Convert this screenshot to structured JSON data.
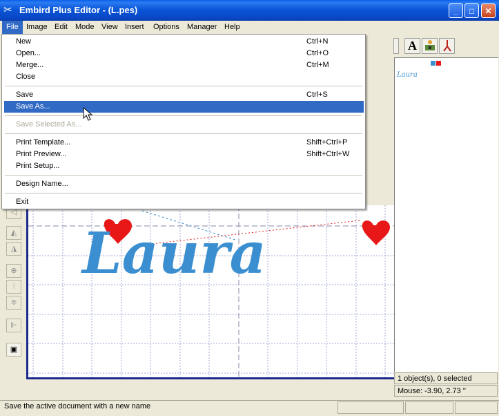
{
  "window": {
    "title": "Embird Plus Editor - (L.pes)"
  },
  "menubar": [
    "File",
    "Image",
    "Edit",
    "Mode",
    "View",
    "Insert",
    "Options",
    "Manager",
    "Help"
  ],
  "file_menu": {
    "new": {
      "label": "New",
      "shortcut": "Ctrl+N"
    },
    "open": {
      "label": "Open...",
      "shortcut": "Ctrl+O"
    },
    "merge": {
      "label": "Merge...",
      "shortcut": "Ctrl+M"
    },
    "close": {
      "label": "Close"
    },
    "save": {
      "label": "Save",
      "shortcut": "Ctrl+S"
    },
    "save_as": {
      "label": "Save As..."
    },
    "save_selected_as": {
      "label": "Save Selected As..."
    },
    "print_template": {
      "label": "Print Template...",
      "shortcut": "Shift+Ctrl+P"
    },
    "print_preview": {
      "label": "Print Preview...",
      "shortcut": "Shift+Ctrl+W"
    },
    "print_setup": {
      "label": "Print Setup..."
    },
    "design_name": {
      "label": "Design Name..."
    },
    "exit": {
      "label": "Exit"
    }
  },
  "design": {
    "text": "Laura",
    "thread_color": "#3b8fd0",
    "heart_color": "#e81818"
  },
  "preview": {
    "text": "Laura"
  },
  "status": {
    "objects": "1 object(s), 0 selected",
    "mouse": "Mouse: -3.90, 2.73 ''",
    "message": "Save the active document with a new name"
  },
  "colors": {
    "titlebar": "#0a56d8",
    "selection": "#316ac5",
    "frame": "#1a2a8c"
  },
  "icons": [
    "app-icon",
    "minimize-icon",
    "maximize-icon",
    "close-icon",
    "text-tool-icon",
    "embroidery-machine-icon",
    "scissors-icon",
    "mouse-cursor-icon"
  ]
}
